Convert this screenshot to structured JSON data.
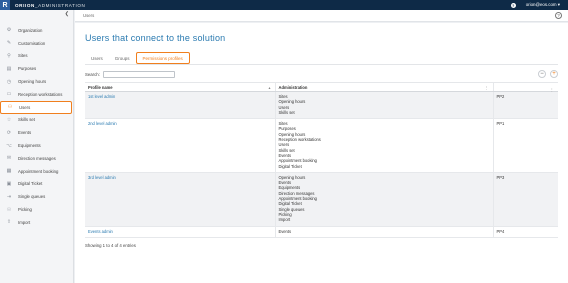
{
  "topbar": {
    "logo": "R",
    "title_bold": "ORIION",
    "title_light": "_ADMINISTRATION",
    "help": "?",
    "user": "orion@eos.com"
  },
  "sidebar": {
    "collapse": "❮",
    "items": [
      {
        "icon": "⚙",
        "label": "Organization"
      },
      {
        "icon": "✎",
        "label": "Customisation"
      },
      {
        "icon": "⚲",
        "label": "Sites"
      },
      {
        "icon": "▤",
        "label": "Purposes"
      },
      {
        "icon": "◷",
        "label": "Opening hours"
      },
      {
        "icon": "▭",
        "label": "Reception workstations"
      },
      {
        "icon": "⚇",
        "label": "Users",
        "active": true
      },
      {
        "icon": "☆",
        "label": "Skills set"
      },
      {
        "icon": "⟳",
        "label": "Events"
      },
      {
        "icon": "⌥",
        "label": "Equipments"
      },
      {
        "icon": "✉",
        "label": "Direction messages"
      },
      {
        "icon": "▦",
        "label": "Appointment booking"
      },
      {
        "icon": "▣",
        "label": "Digital Ticket"
      },
      {
        "icon": "⇥",
        "label": "Single queues"
      },
      {
        "icon": "☉",
        "label": "Picking"
      },
      {
        "icon": "⇧",
        "label": "Import"
      }
    ]
  },
  "breadcrumb": "Users",
  "help_icon": "?",
  "page_title": "Users that connect to the solution",
  "tabs": [
    {
      "label": "Users"
    },
    {
      "label": "Groups"
    },
    {
      "label": "Permissions profiles",
      "active": true
    }
  ],
  "search": {
    "label": "Search:",
    "value": ""
  },
  "actions": {
    "remove": "−",
    "add": "+"
  },
  "table": {
    "headers": {
      "name": "Profile name",
      "admin": "Administration",
      "code": ""
    },
    "rows": [
      {
        "name": "1st level admin",
        "admin": [
          "Sites",
          "Opening hours",
          "Users",
          "Skills set"
        ],
        "code": "PP2",
        "alt": true
      },
      {
        "name": "2nd level admin",
        "admin": [
          "Sites",
          "Purposes",
          "Opening hours",
          "Reception workstations",
          "Users",
          "Skills set",
          "Events",
          "Appointment booking",
          "Digital Ticket"
        ],
        "code": "PP1",
        "alt": false
      },
      {
        "name": "3rd level admin",
        "admin": [
          "Opening hours",
          "Events",
          "Equipments",
          "Direction messages",
          "Appointment booking",
          "Digital Ticket",
          "Single queues",
          "Picking",
          "Import"
        ],
        "code": "PP3",
        "alt": true
      },
      {
        "name": "Events admin",
        "admin": [
          "Events"
        ],
        "code": "PP4",
        "alt": false
      }
    ]
  },
  "footer": "Showing 1 to 4 of 4 entries"
}
